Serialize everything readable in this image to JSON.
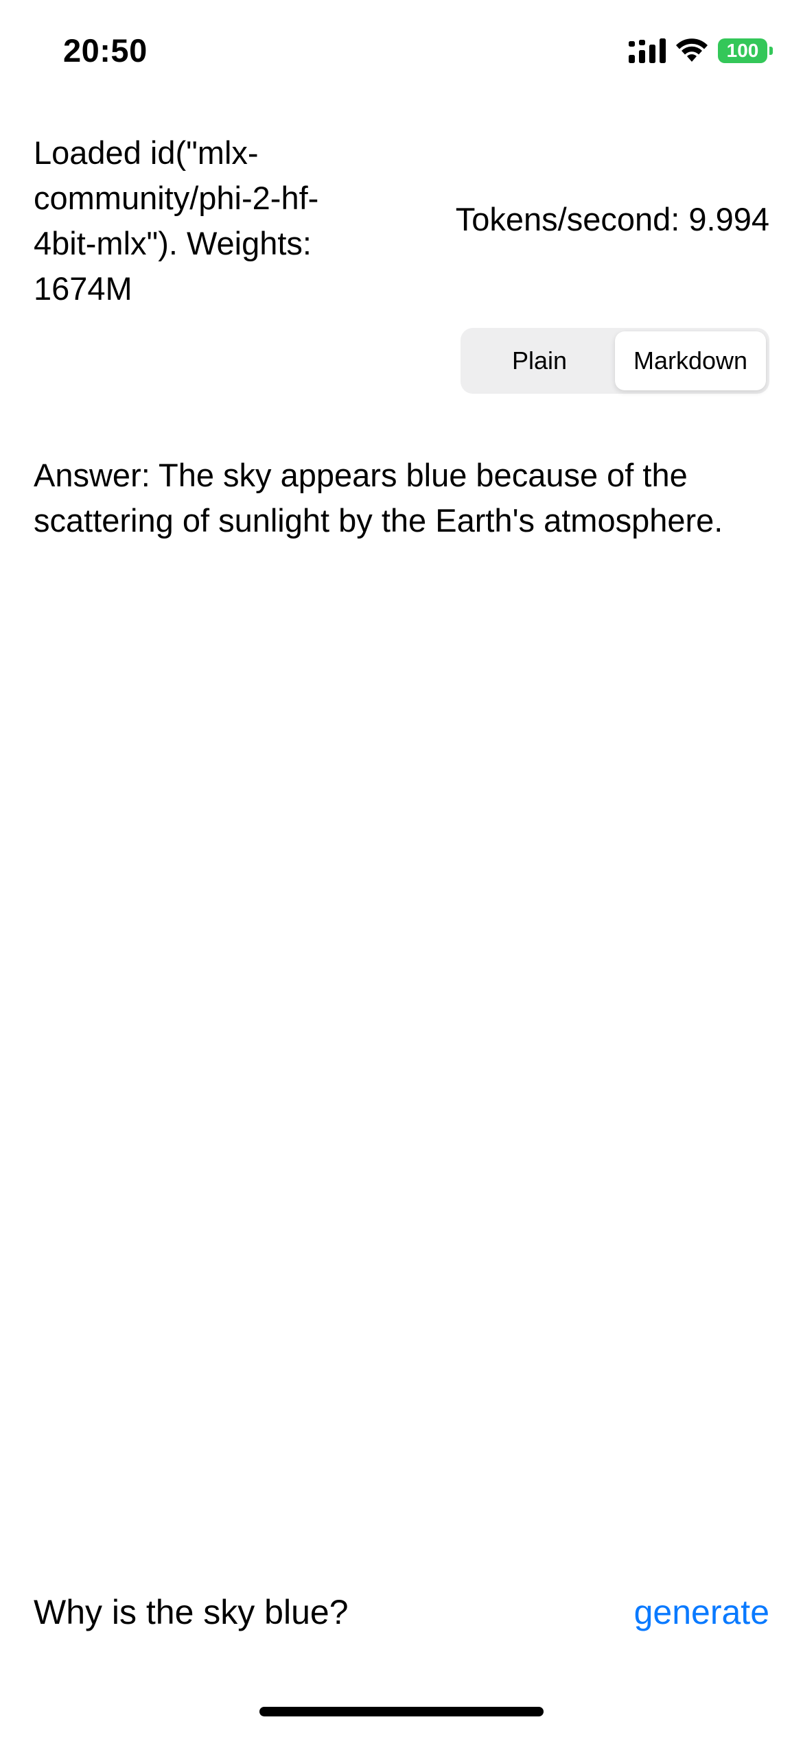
{
  "status_bar": {
    "time": "20:50",
    "battery_level": "100",
    "signal_icon": "cellular-signal-icon",
    "wifi_icon": "wifi-icon",
    "battery_color": "#34c759"
  },
  "header": {
    "model_info": "Loaded id(\"mlx-community/phi-2-hf-4bit-mlx\"). Weights: 1674M",
    "tokens_rate": "Tokens/second: 9.994"
  },
  "display_mode": {
    "options": [
      "Plain",
      "Markdown"
    ],
    "selected": "Markdown"
  },
  "output": {
    "text": "Answer: The sky appears blue because of the scattering of sunlight by the Earth's atmosphere."
  },
  "prompt": {
    "value": "Why is the sky blue?",
    "action_label": "generate",
    "action_color": "#0a7aff"
  }
}
